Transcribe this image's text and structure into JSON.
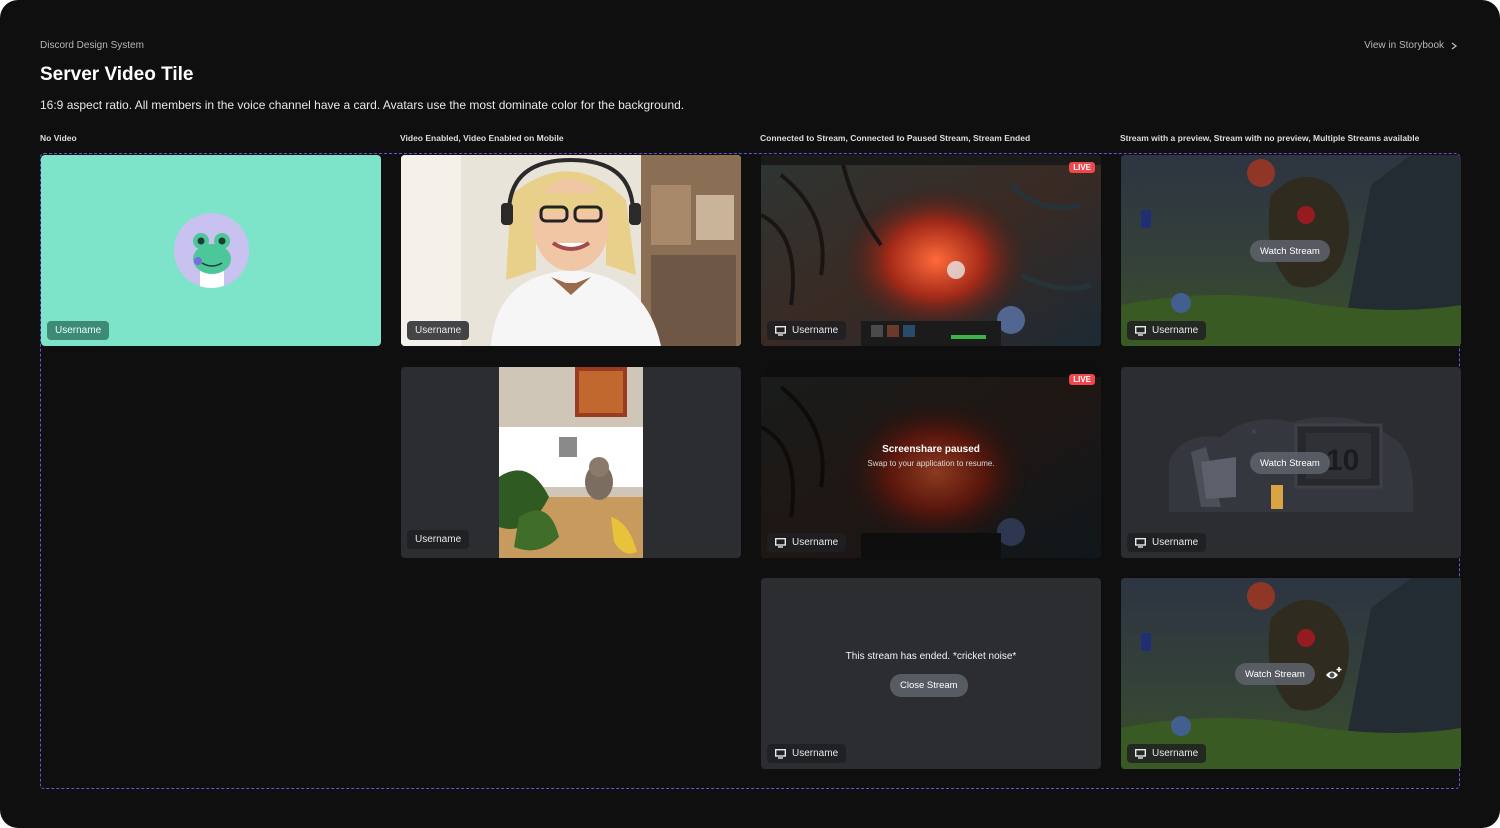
{
  "header": {
    "system_label": "Discord Design System",
    "storybook_link": "View in Storybook",
    "title": "Server Video Tile",
    "description": "16:9 aspect ratio. All members in the voice channel have a card. Avatars use the most dominate color for the background."
  },
  "columns": [
    {
      "label": "No Video"
    },
    {
      "label": "Video Enabled, Video Enabled on Mobile"
    },
    {
      "label": "Connected to Stream, Connected to Paused Stream, Stream Ended"
    },
    {
      "label": "Stream with a preview, Stream with no preview, Multiple Streams available"
    }
  ],
  "tiles": {
    "no_video": {
      "username": "Username"
    },
    "video_enabled": {
      "username": "Username"
    },
    "video_mobile": {
      "username": "Username"
    },
    "stream_connected": {
      "username": "Username",
      "live": "LIVE"
    },
    "stream_paused": {
      "username": "Username",
      "live": "LIVE",
      "paused_title": "Screenshare paused",
      "paused_sub": "Swap to your application to resume."
    },
    "stream_ended": {
      "username": "Username",
      "message": "This stream has ended. *cricket noise*",
      "button": "Close Stream"
    },
    "stream_preview": {
      "username": "Username",
      "button": "Watch Stream"
    },
    "stream_no_preview": {
      "username": "Username",
      "button": "Watch Stream"
    },
    "stream_multiple": {
      "username": "Username",
      "button": "Watch Stream"
    }
  },
  "colors": {
    "avatar_background": "#7ee4c9",
    "live_badge": "#f0464e",
    "dashed_border": "#6b54d6"
  },
  "icons": {
    "screen": "monitor-icon",
    "chevron": "chevron-right-icon",
    "multi_stream": "eye-plus-icon"
  }
}
